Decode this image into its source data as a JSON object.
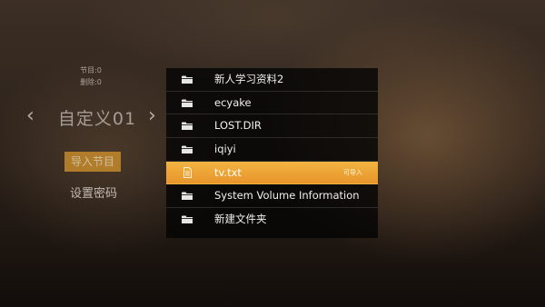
{
  "stats": {
    "programs": "节目:0",
    "deleted": "删除:0"
  },
  "group": {
    "name": "自定义01",
    "prev_icon": "chevron-left-icon",
    "next_icon": "chevron-right-icon"
  },
  "actions": {
    "import_label": "导入节目",
    "password_label": "设置密码"
  },
  "files": [
    {
      "name": "新人学习资料2",
      "type": "folder",
      "icon": "folder-icon"
    },
    {
      "name": "ecyake",
      "type": "folder",
      "icon": "folder-icon"
    },
    {
      "name": "LOST.DIR",
      "type": "folder",
      "icon": "folder-icon"
    },
    {
      "name": "iqiyi",
      "type": "folder",
      "icon": "folder-icon"
    },
    {
      "name": "tv.txt",
      "type": "file",
      "icon": "text-file-icon",
      "badge": "可导入",
      "selected": true
    },
    {
      "name": "System Volume Information",
      "type": "folder",
      "icon": "folder-icon"
    },
    {
      "name": "新建文件夹",
      "type": "folder",
      "icon": "folder-icon"
    }
  ],
  "colors": {
    "accent": "#f0a73a",
    "list_bg": "#050505",
    "text": "#f0f0f0"
  }
}
